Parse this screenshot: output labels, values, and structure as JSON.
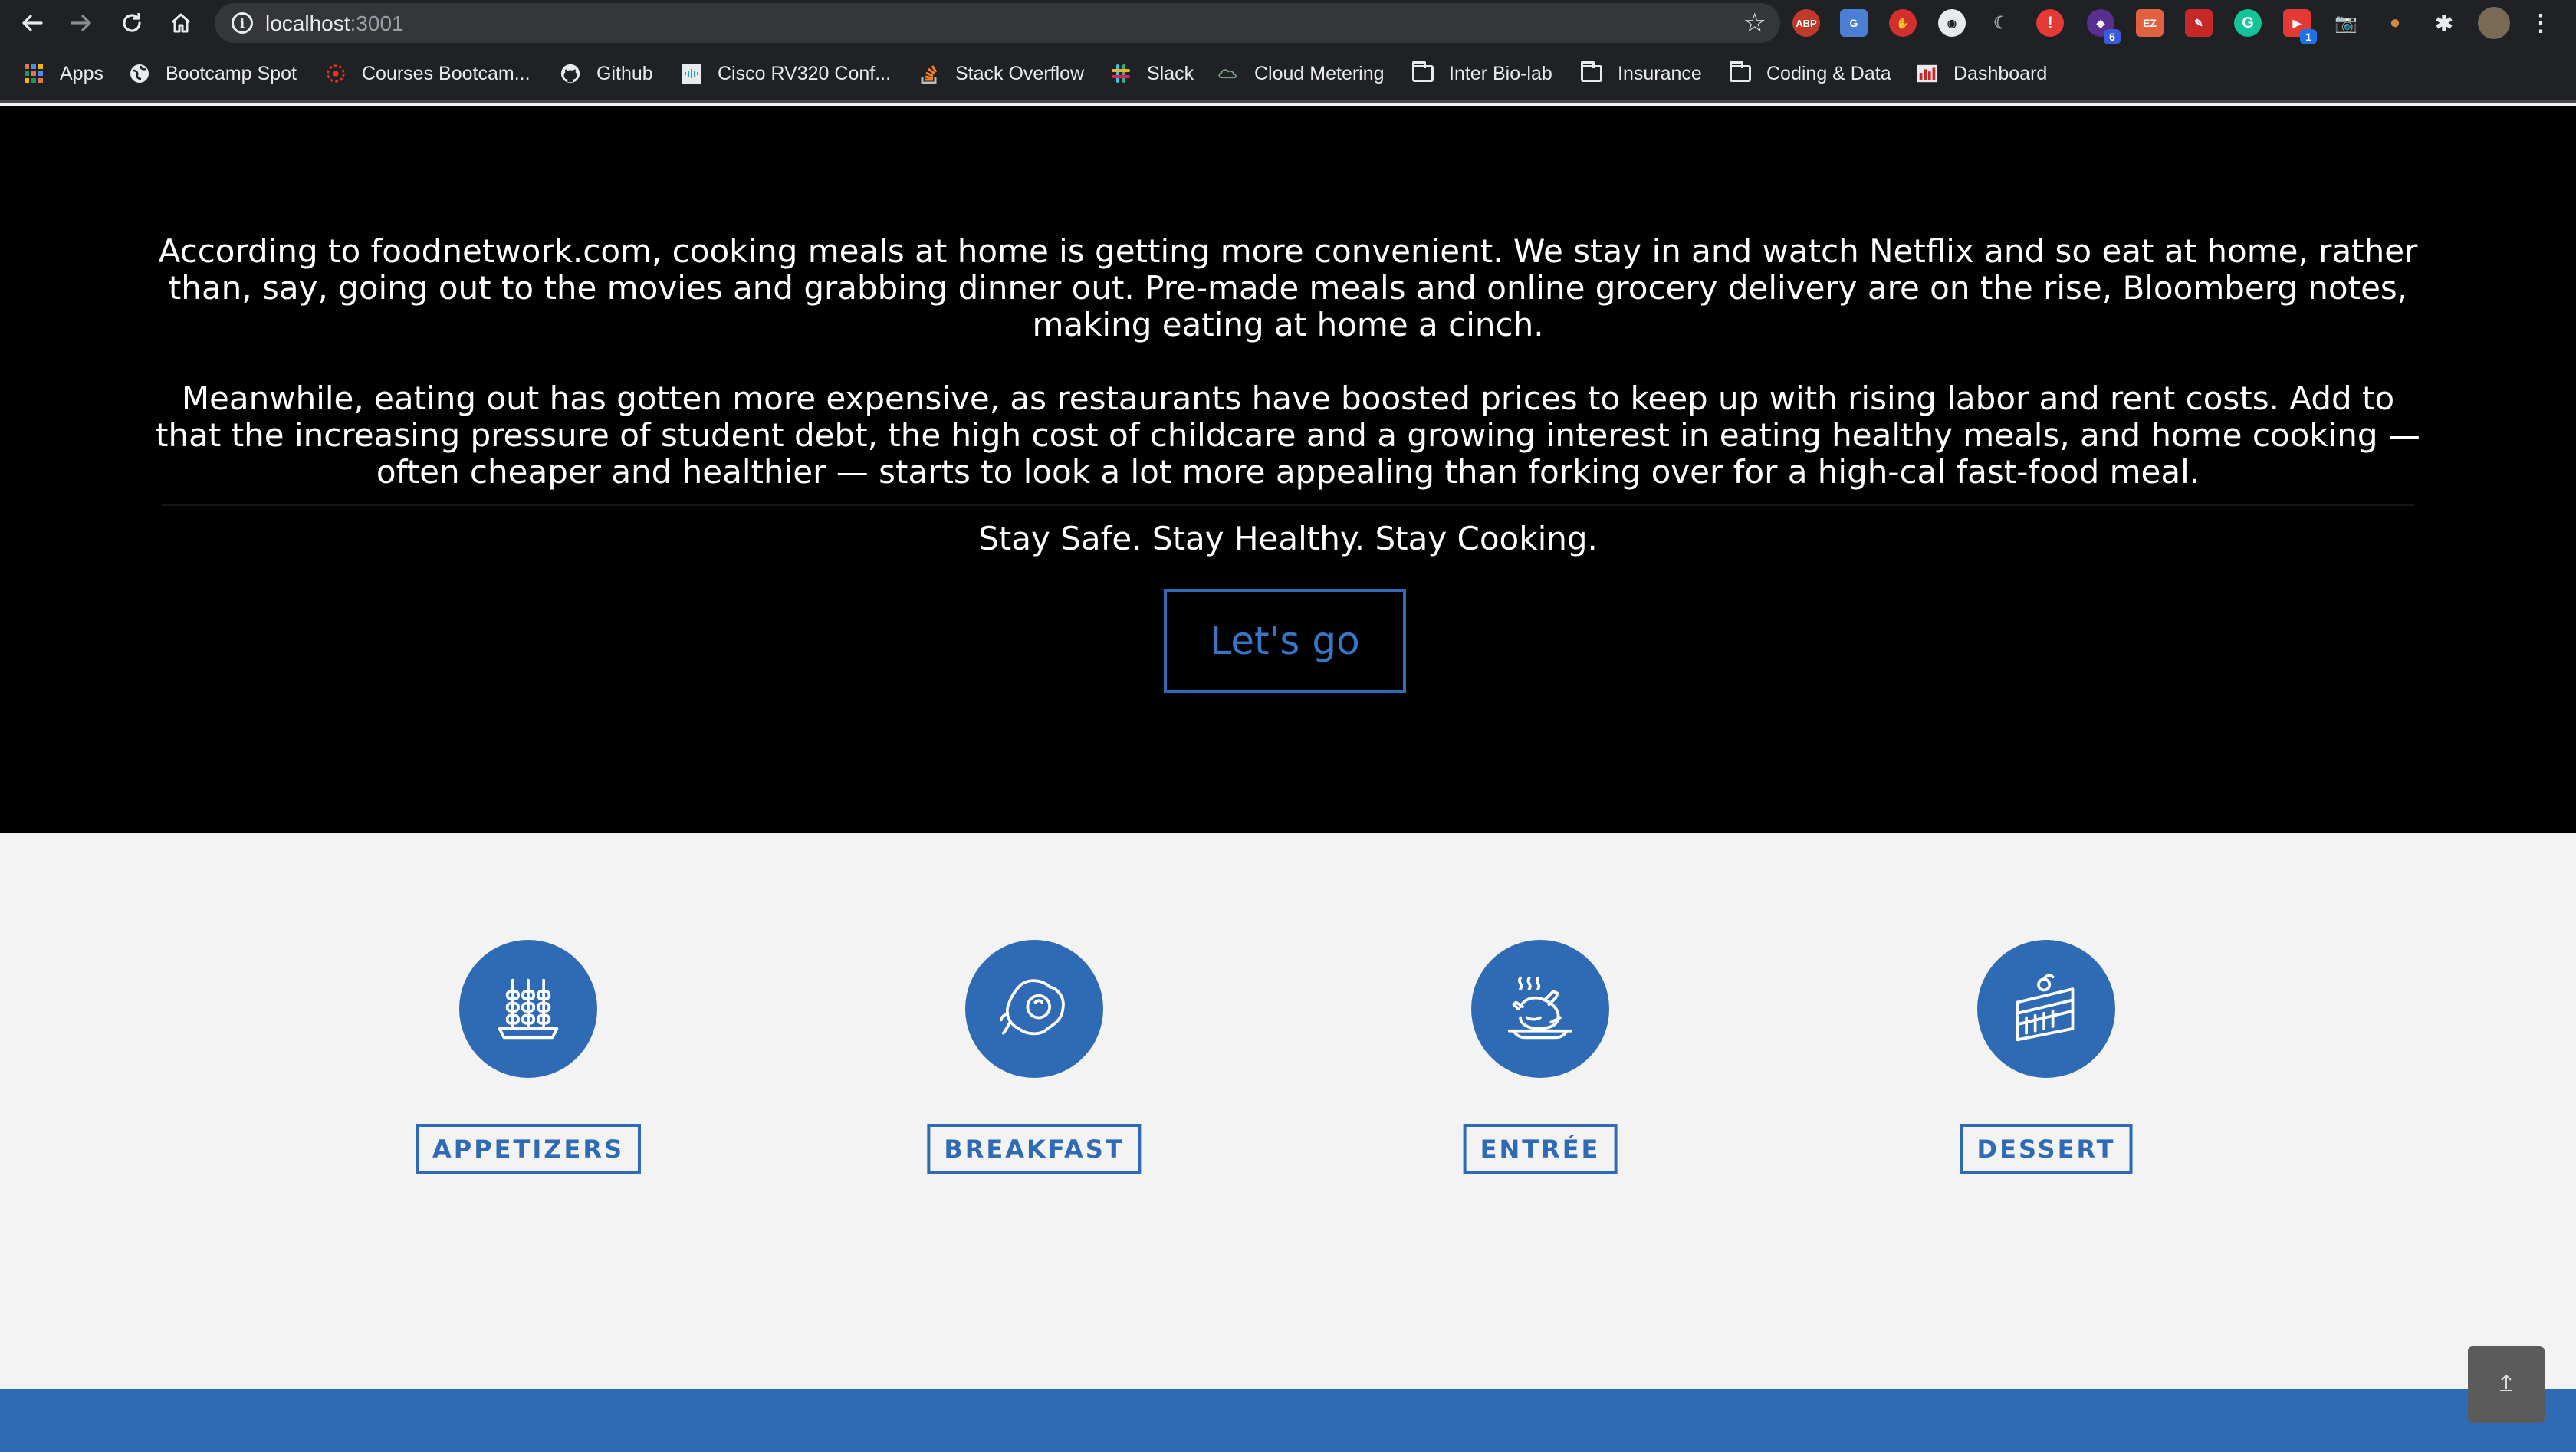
{
  "browser": {
    "url_host": "localhost",
    "url_port": ":3001",
    "bookmarks": [
      {
        "label": "Apps",
        "icon": "apps-grid-icon"
      },
      {
        "label": "Bootcamp Spot",
        "icon": "globe-icon"
      },
      {
        "label": "Courses Bootcam...",
        "icon": "wheel-icon"
      },
      {
        "label": "Github",
        "icon": "github-icon"
      },
      {
        "label": "Cisco RV320 Conf...",
        "icon": "cisco-icon"
      },
      {
        "label": "Stack Overflow",
        "icon": "stackoverflow-icon"
      },
      {
        "label": "Slack",
        "icon": "slack-icon"
      },
      {
        "label": "Cloud Metering",
        "icon": "cloud-metering-icon"
      },
      {
        "label": "Inter Bio-lab",
        "icon": "folder-icon"
      },
      {
        "label": "Insurance",
        "icon": "folder-icon"
      },
      {
        "label": "Coding & Data",
        "icon": "folder-icon"
      },
      {
        "label": "Dashboard",
        "icon": "dashboard-icon"
      }
    ],
    "extensions": {
      "abp": "ABP",
      "badge_purple": "6",
      "badge_blue": "1"
    }
  },
  "hero": {
    "paragraph1": "According to foodnetwork.com, cooking meals at home is getting more convenient. We stay in and watch Netflix and so eat at home, rather than, say, going out to the movies and grabbing dinner out. Pre-made meals and online grocery delivery are on the rise, Bloomberg notes, making eating at home a cinch.",
    "paragraph2": "Meanwhile, eating out has gotten more expensive, as restaurants have boosted prices to keep up with rising labor and rent costs. Add to that the increasing pressure of student debt, the high cost of childcare and a growing interest in eating healthy meals, and home cooking — often cheaper and healthier — starts to look a lot more appealing than forking over for a high-cal fast-food meal.",
    "tagline": "Stay Safe. Stay Healthy. Stay Cooking.",
    "cta_label": "Let's go"
  },
  "categories": [
    {
      "label": "APPETIZERS",
      "icon": "skewers-icon"
    },
    {
      "label": "BREAKFAST",
      "icon": "fried-egg-icon"
    },
    {
      "label": "ENTRÉE",
      "icon": "roast-chicken-icon"
    },
    {
      "label": "DESSERT",
      "icon": "cake-slice-icon"
    }
  ],
  "scroll_top_icon": "arrow-up-icon",
  "colors": {
    "brand_blue": "#2f6ab5",
    "hero_bg": "#000000",
    "page_bg": "#f3f3f3"
  }
}
